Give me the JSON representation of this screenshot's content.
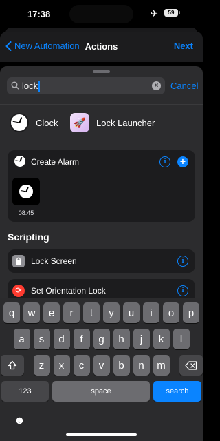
{
  "status": {
    "time": "17:38",
    "battery": "59"
  },
  "nav": {
    "back_label": "New Automation",
    "title": "Actions",
    "next_label": "Next"
  },
  "search": {
    "value": "lock",
    "cancel_label": "Cancel"
  },
  "apps": [
    {
      "label": "Clock",
      "icon": "clock-icon"
    },
    {
      "label": "Lock Launcher",
      "icon": "rocket-icon"
    }
  ],
  "alarm_card": {
    "title": "Create Alarm",
    "time": "08:45"
  },
  "scripting": {
    "title": "Scripting",
    "items": [
      {
        "label": "Lock Screen",
        "icon": "lock-icon"
      },
      {
        "label": "Set Orientation Lock",
        "icon": "orientation-lock-icon"
      }
    ]
  },
  "keyboard": {
    "row1": [
      "q",
      "w",
      "e",
      "r",
      "t",
      "y",
      "u",
      "i",
      "o",
      "p"
    ],
    "row2": [
      "a",
      "s",
      "d",
      "f",
      "g",
      "h",
      "j",
      "k",
      "l"
    ],
    "row3": [
      "z",
      "x",
      "c",
      "v",
      "b",
      "n",
      "m"
    ],
    "numbers_label": "123",
    "space_label": "space",
    "search_label": "search"
  },
  "colors": {
    "accent": "#0a84ff",
    "background": "#000000",
    "panel": "#2c2c2e",
    "card": "#1c1c1e",
    "orientation": "#ff3b30"
  }
}
